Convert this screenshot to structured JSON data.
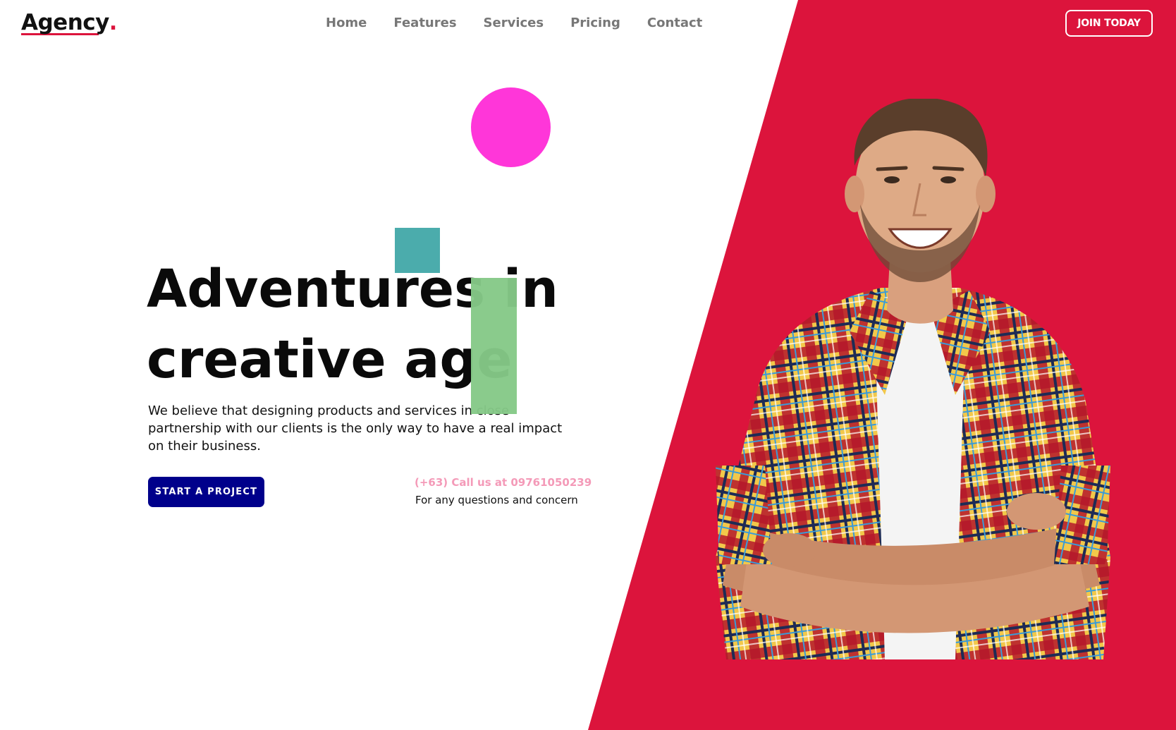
{
  "brand": {
    "logo_text": "Agency",
    "logo_dot": "."
  },
  "nav": {
    "items": [
      {
        "label": "Home"
      },
      {
        "label": "Features"
      },
      {
        "label": "Services"
      },
      {
        "label": "Pricing"
      },
      {
        "label": "Contact"
      }
    ],
    "join_label": "JOIN TODAY"
  },
  "hero": {
    "title_line1": "Adventures in",
    "title_line2": "creative age",
    "description": "We believe that designing products and services in close partnership with our clients is the only way to have a real impact on their business.",
    "cta_label": "START A PROJECT",
    "phone_text": "(+63) Call us at 09761050239",
    "phone_sub": "For any questions and concern"
  },
  "colors": {
    "accent_red": "#dc143c",
    "cta_navy": "#00008b",
    "circle_magenta": "#ff36d9",
    "square_teal": "#4bacac",
    "bar_green": "#85c987",
    "phone_pink": "#f49ab8"
  },
  "illustration": {
    "subject": "smiling man in plaid shirt with arms crossed"
  }
}
